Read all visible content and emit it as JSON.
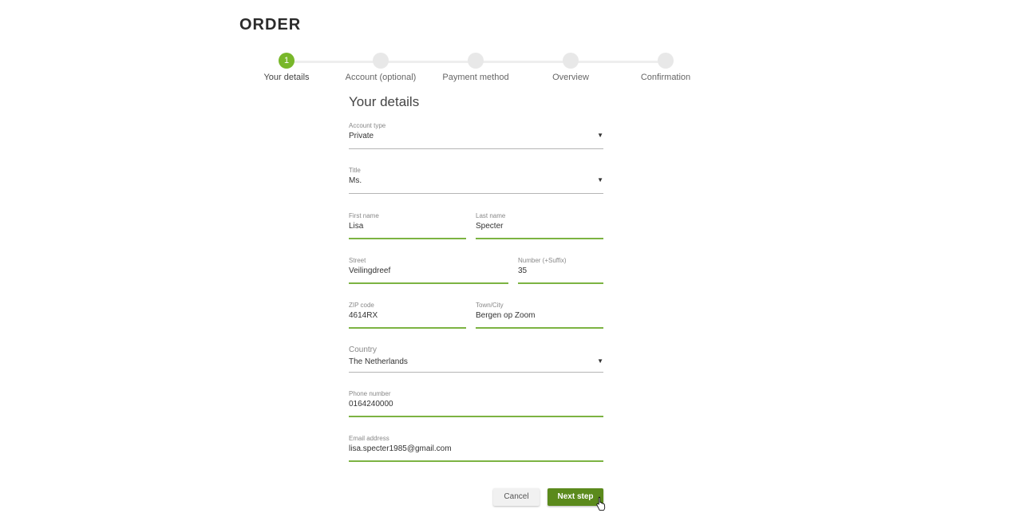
{
  "page": {
    "title": "ORDER",
    "section_title": "Your details"
  },
  "stepper": {
    "steps": [
      {
        "number": "1",
        "label": "Your details",
        "active": true
      },
      {
        "number": "",
        "label": "Account (optional)",
        "active": false
      },
      {
        "number": "",
        "label": "Payment method",
        "active": false
      },
      {
        "number": "",
        "label": "Overview",
        "active": false
      },
      {
        "number": "",
        "label": "Confirmation",
        "active": false
      }
    ]
  },
  "form": {
    "account_type": {
      "label": "Account type",
      "value": "Private"
    },
    "title": {
      "label": "Title",
      "value": "Ms."
    },
    "first_name": {
      "label": "First name",
      "value": "Lisa"
    },
    "last_name": {
      "label": "Last name",
      "value": "Specter"
    },
    "street": {
      "label": "Street",
      "value": "Veilingdreef"
    },
    "number": {
      "label": "Number (+Suffix)",
      "value": "35"
    },
    "zip": {
      "label": "ZIP code",
      "value": "4614RX"
    },
    "city": {
      "label": "Town/City",
      "value": "Bergen op Zoom"
    },
    "country": {
      "label": "Country",
      "value": "The Netherlands"
    },
    "phone": {
      "label": "Phone number",
      "value": "0164240000"
    },
    "email": {
      "label": "Email address",
      "value": "lisa.specter1985@gmail.com"
    },
    "dropdown_caret": "▼"
  },
  "buttons": {
    "cancel_label": "Cancel",
    "next_label": "Next step"
  },
  "colors": {
    "accent": "#78b72a",
    "primary_button": "#5b8a1c",
    "input_underline_valid": "#7cb342"
  },
  "icons": {
    "cursor": "hand-pointer-icon",
    "caret": "caret-down-icon"
  }
}
